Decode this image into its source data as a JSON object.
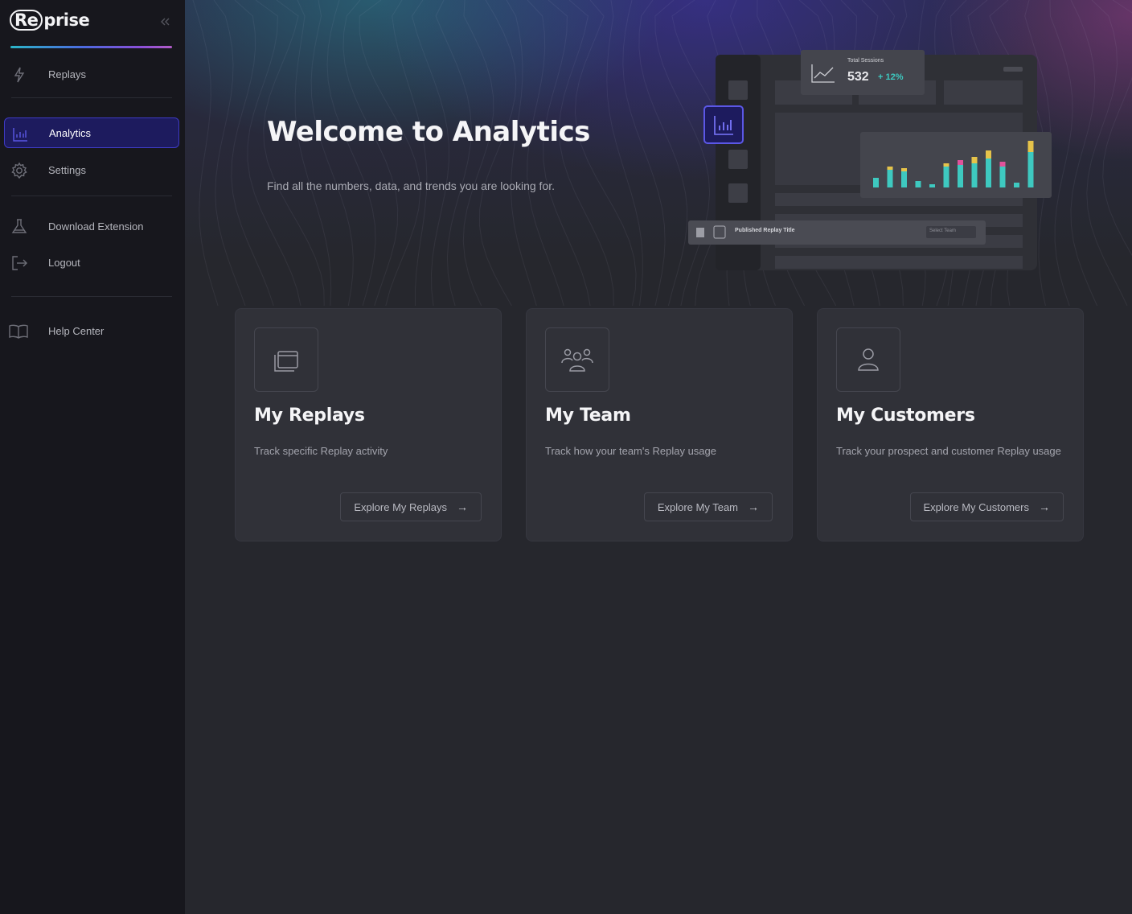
{
  "app": {
    "logo_prefix": "Re",
    "logo_suffix": "prise"
  },
  "sidebar": {
    "items": [
      {
        "label": "Replays",
        "icon": "lightning-icon"
      },
      {
        "label": "Analytics",
        "icon": "bar-chart-icon",
        "active": true
      },
      {
        "label": "Settings",
        "icon": "gear-icon"
      },
      {
        "label": "Download Extension",
        "icon": "flask-icon"
      },
      {
        "label": "Logout",
        "icon": "logout-icon"
      },
      {
        "label": "Help Center",
        "icon": "book-icon"
      }
    ]
  },
  "hero": {
    "title": "Welcome to Analytics",
    "subtitle": "Find all the numbers, data, and trends you are looking for."
  },
  "illustration": {
    "metric_label": "Total Sessions",
    "metric_value": "532",
    "metric_change": "+ 12%",
    "row_label": "Published Replay Title",
    "row_select": "Select Team"
  },
  "cards": [
    {
      "title": "My Replays",
      "description": "Track specific Replay activity",
      "button": "Explore My Replays",
      "icon": "replays-window-icon"
    },
    {
      "title": "My Team",
      "description": "Track how your team's Replay usage",
      "button": "Explore My Team",
      "icon": "team-icon"
    },
    {
      "title": "My Customers",
      "description": "Track your prospect and customer Replay usage",
      "button": "Explore My Customers",
      "icon": "user-icon"
    }
  ],
  "colors": {
    "accent": "#3e3ac3",
    "teal": "#3ec9c0",
    "pink": "#e0529a",
    "yellow": "#e6c34a"
  }
}
